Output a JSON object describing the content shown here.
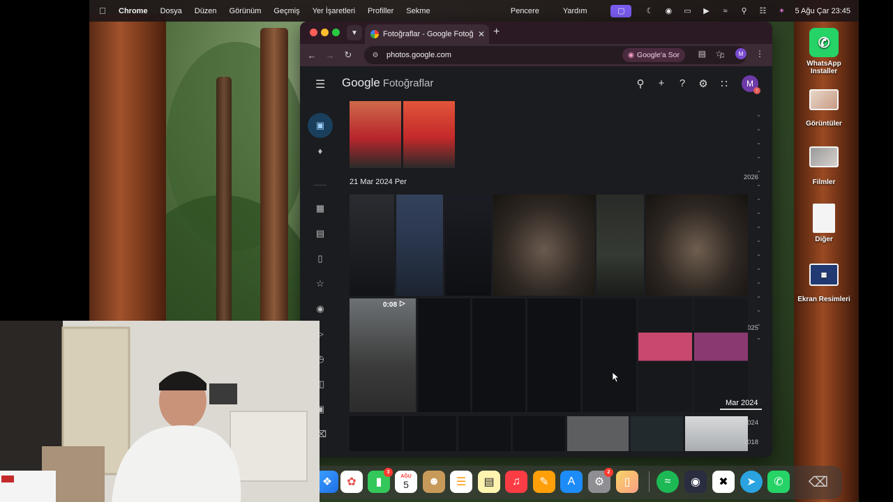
{
  "menubar": {
    "app_name": "Chrome",
    "menus": [
      "Dosya",
      "Düzen",
      "Görünüm",
      "Geçmiş",
      "Yer İşaretleri",
      "Profiller",
      "Sekme"
    ],
    "right_menus": [
      "Pencere",
      "Yardım"
    ],
    "datetime": "5 Ağu Çar  23:45"
  },
  "desktop_icons": [
    {
      "label_line1": "WhatsApp",
      "label_line2": "Installer",
      "icon": "whatsapp-installer-icon"
    },
    {
      "label_line1": "Görüntüler",
      "label_line2": "",
      "icon": "folder-images-icon"
    },
    {
      "label_line1": "Filmler",
      "label_line2": "",
      "icon": "folder-movies-icon"
    },
    {
      "label_line1": "Diğer",
      "label_line2": "",
      "icon": "document-icon"
    },
    {
      "label_line1": "Ekran Resimleri",
      "label_line2": "",
      "icon": "folder-screenshots-icon"
    }
  ],
  "browser": {
    "tab_title": "Fotoğraflar - Google Fotoğr",
    "address": "photos.google.com",
    "ask_google": "Google'a Sor",
    "profile_initial": "M"
  },
  "photos": {
    "logo_google": "Google",
    "logo_product": "Fotoğraflar",
    "avatar_initial": "M",
    "date_heading": "21 Mar 2024 Per",
    "video_duration": "0:08",
    "scrubber_label": "Mar 2024",
    "years": [
      "2026",
      "2025",
      "2024",
      "2018"
    ]
  },
  "dock": {
    "calendar_month": "AĞU",
    "calendar_day": "5",
    "badges": {
      "facetime": "3",
      "system_settings": "2"
    }
  },
  "colors": {
    "accent_purple": "#7b5cf0",
    "chrome_frame": "#3c2a35",
    "photos_bg": "#1b1c1f",
    "rail_active": "#1a3f5c"
  }
}
